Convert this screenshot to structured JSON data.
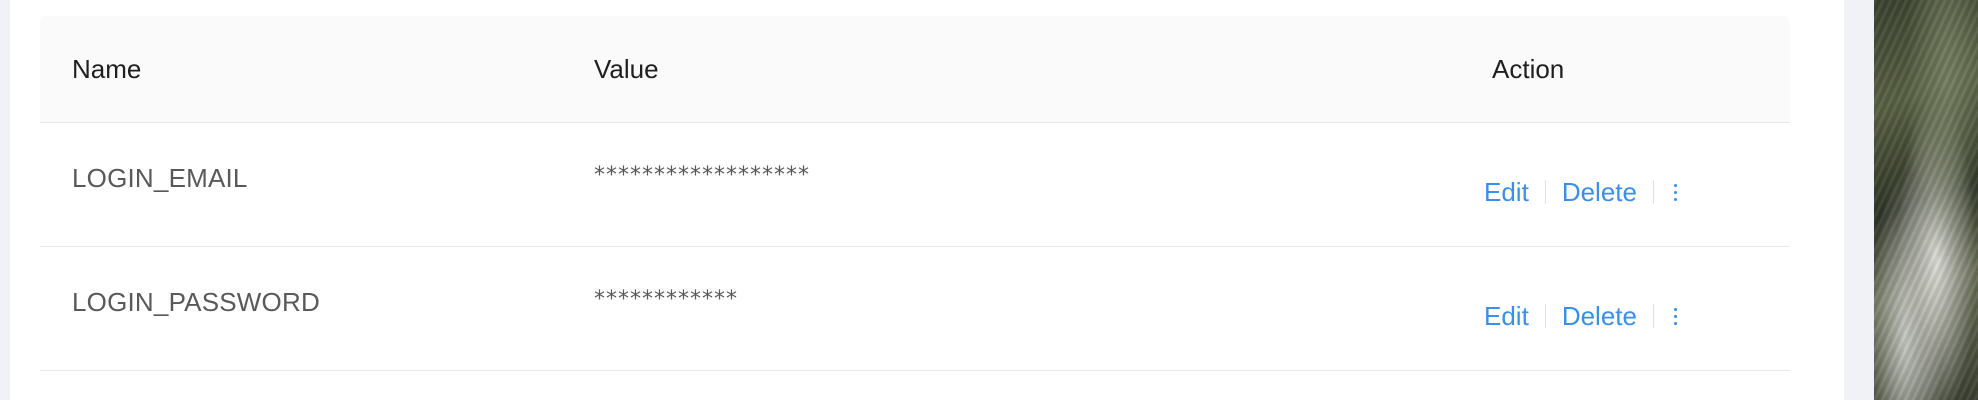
{
  "table": {
    "columns": {
      "name": "Name",
      "value": "Value",
      "action": "Action"
    },
    "rows": [
      {
        "name": "LOGIN_EMAIL",
        "value": "******************",
        "actions": {
          "edit": "Edit",
          "delete": "Delete",
          "more_icon": "more-vertical-icon"
        }
      },
      {
        "name": "LOGIN_PASSWORD",
        "value": "************",
        "actions": {
          "edit": "Edit",
          "delete": "Delete",
          "more_icon": "more-vertical-icon"
        }
      }
    ]
  },
  "colors": {
    "link": "#3b8fe8",
    "header_bg": "#fafafa",
    "page_bg": "#f0f2f5",
    "text": "#595959"
  },
  "background_image": "mountain-photo"
}
